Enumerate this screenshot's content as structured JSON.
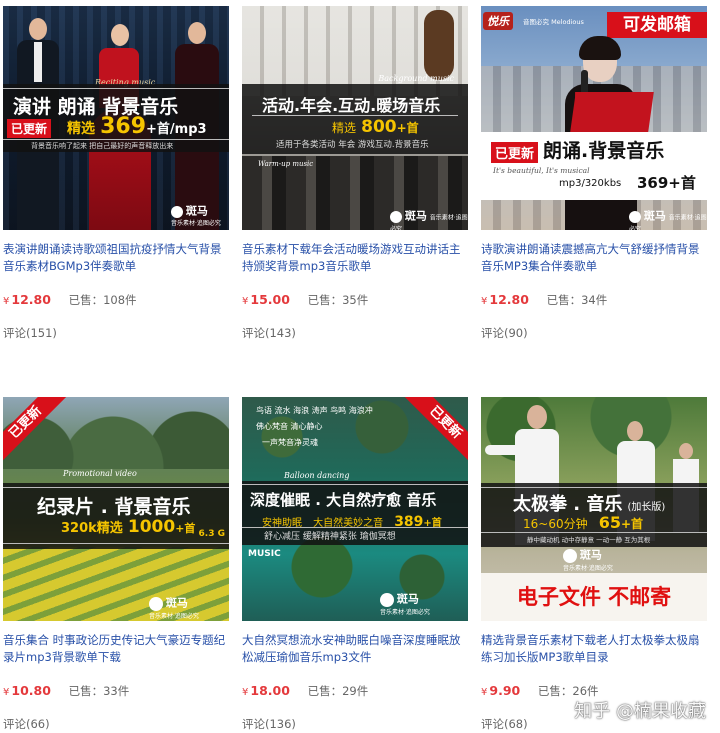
{
  "products": [
    {
      "title": "表演讲朗诵读诗歌颂祖国抗疫抒情大气背景音乐素材BGMp3伴奏歌单",
      "currency": "¥",
      "price": "12.80",
      "sold_label": "已售：",
      "sold_count": "108件",
      "review_label": "评论(151)",
      "image": {
        "headline": "演讲 朗诵 背景音乐",
        "badge": "已更新",
        "sub_prefix": "精选",
        "sub_number": "369",
        "sub_suffix": "+首/mp3",
        "tagline": "背景音乐响了起来  把自己最好的声音释放出来",
        "script_small": "Reciting music",
        "logo_name": "斑马",
        "logo_sub": "音乐素材·追图必究"
      }
    },
    {
      "title": "音乐素材下载年会活动暖场游戏互动讲话主持颁奖背景mp3音乐歌单",
      "currency": "¥",
      "price": "15.00",
      "sold_label": "已售：",
      "sold_count": "35件",
      "review_label": "评论(143)",
      "image": {
        "headline": "活动.年会.互动.暖场音乐",
        "sub_prefix": "精选",
        "sub_number": "800",
        "sub_suffix": "+首",
        "tagline": "适用于各类活动  年会  游戏互动.背景音乐",
        "script_small": "Background music",
        "script_small2": "Warm-up music",
        "logo_name": "斑马",
        "logo_sub": "音乐素材·追图必究"
      }
    },
    {
      "title": "诗歌演讲朗诵读震撼高亢大气舒缓抒情背景音乐MP3集合伴奏歌单",
      "currency": "¥",
      "price": "12.80",
      "sold_label": "已售：",
      "sold_count": "34件",
      "review_label": "评论(90)",
      "image": {
        "top_label": "可发邮箱",
        "brand": "悦乐",
        "brand_sub": "音图必究 Melodious",
        "badge": "已更新",
        "headline": "朗诵.背景音乐",
        "script_small": "It's beautiful, It's musical",
        "format": "mp3/320kbs",
        "count": "369+首",
        "logo_name": "斑马",
        "logo_sub": "音乐素材·追图必究"
      }
    },
    {
      "title": "音乐集合 时事政论历史传记大气豪迈专题纪录片mp3背景歌单下载",
      "currency": "¥",
      "price": "10.80",
      "sold_label": "已售：",
      "sold_count": "33件",
      "review_label": "评论(66)",
      "image": {
        "ribbon": "已更新",
        "script_small": "Promotional video",
        "headline": "纪录片 . 背景音乐",
        "sub_prefix": "320k精选",
        "sub_number": "1000",
        "sub_suffix": "+首",
        "size": "6.3 G",
        "logo_name": "斑马",
        "logo_sub": "音乐素材·追图必究"
      }
    },
    {
      "title": "大自然冥想流水安神助眠白噪音深度睡眠放松减压瑜伽音乐mp3文件",
      "currency": "¥",
      "price": "18.00",
      "sold_label": "已售：",
      "sold_count": "29件",
      "review_label": "评论(136)",
      "image": {
        "ribbon": "已更新",
        "top_line1": "鸟语  流水  海浪  涛声  鸟鸣  海浪冲",
        "top_line2": "佛心梵音  清心静心",
        "top_line3": "一声梵音净灵魂",
        "script_small": "Balloon dancing",
        "headline": "深度催眠 . 大自然疗愈 音乐",
        "sub_left": "安神助眠",
        "sub_mid": "大自然美妙之音",
        "sub_number": "389",
        "sub_suffix": "+首",
        "sub_line2": "舒心减压  缓解精神紧张  瑜伽冥想",
        "music_tag": "MUSIC",
        "logo_name": "斑马",
        "logo_sub": "音乐素材·追图必究"
      }
    },
    {
      "title": "精选背景音乐素材下载老人打太极拳太极扇练习加长版MP3歌单目录",
      "currency": "¥",
      "price": "9.90",
      "sold_label": "已售：",
      "sold_count": "26件",
      "review_label": "评论(68)",
      "image": {
        "headline": "太极拳 . 音乐",
        "headline_small": "(加长版)",
        "sub_prefix": "16~60",
        "sub_unit": "分钟",
        "sub_number": "65",
        "sub_suffix": "+首",
        "tagline": "静中藏动机  动中存静意  一动一静  互为其根",
        "footer": "电子文件 不邮寄",
        "logo_name": "斑马",
        "logo_sub": "音乐素材·追图必究"
      }
    }
  ],
  "watermark": "知乎 @楠果收藏",
  "colors": {
    "price": "#e4393c",
    "title_link": "#2850a8",
    "gold": "#f5c400",
    "badge_red": "#d8101a"
  }
}
